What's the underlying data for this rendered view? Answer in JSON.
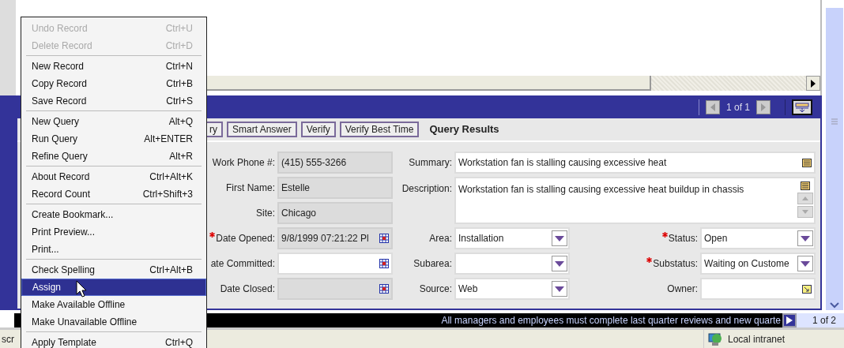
{
  "context_menu": {
    "groups": [
      [
        {
          "label": "Undo Record",
          "shortcut": "Ctrl+U",
          "disabled": true,
          "selected": false
        },
        {
          "label": "Delete Record",
          "shortcut": "Ctrl+D",
          "disabled": true,
          "selected": false
        }
      ],
      [
        {
          "label": "New Record",
          "shortcut": "Ctrl+N",
          "disabled": false,
          "selected": false
        },
        {
          "label": "Copy Record",
          "shortcut": "Ctrl+B",
          "disabled": false,
          "selected": false
        },
        {
          "label": "Save Record",
          "shortcut": "Ctrl+S",
          "disabled": false,
          "selected": false
        }
      ],
      [
        {
          "label": "New Query",
          "shortcut": "Alt+Q",
          "disabled": false,
          "selected": false
        },
        {
          "label": "Run Query",
          "shortcut": "Alt+ENTER",
          "disabled": false,
          "selected": false
        },
        {
          "label": "Refine Query",
          "shortcut": "Alt+R",
          "disabled": false,
          "selected": false
        }
      ],
      [
        {
          "label": "About Record",
          "shortcut": "Ctrl+Alt+K",
          "disabled": false,
          "selected": false
        },
        {
          "label": "Record Count",
          "shortcut": "Ctrl+Shift+3",
          "disabled": false,
          "selected": false
        }
      ],
      [
        {
          "label": "Create Bookmark...",
          "disabled": false,
          "selected": false
        },
        {
          "label": "Print Preview...",
          "disabled": false,
          "selected": false
        },
        {
          "label": "Print...",
          "disabled": false,
          "selected": false
        }
      ],
      [
        {
          "label": "Check Spelling",
          "shortcut": "Ctrl+Alt+B",
          "disabled": false,
          "selected": false
        },
        {
          "label": "Assign",
          "disabled": false,
          "selected": true
        },
        {
          "label": "Make Available Offline",
          "disabled": false,
          "selected": false
        },
        {
          "label": "Make Unavailable Offline",
          "disabled": false,
          "selected": false
        }
      ],
      [
        {
          "label": "Apply Template",
          "shortcut": "Ctrl+Q",
          "disabled": false,
          "selected": false
        }
      ]
    ]
  },
  "record_panel": {
    "pager": "1 of 1",
    "toolbar": {
      "buttons": [
        "ry",
        "Smart Answer",
        "Verify",
        "Verify Best Time"
      ],
      "title": "Query Results"
    },
    "left_fields": [
      {
        "label": "Work Phone #:",
        "value": "(415) 555-3266",
        "kind": "text",
        "readonly": true,
        "required": false
      },
      {
        "label": "First Name:",
        "value": "Estelle",
        "kind": "text",
        "readonly": true,
        "required": false
      },
      {
        "label": "Site:",
        "value": "Chicago",
        "kind": "text",
        "readonly": true,
        "required": false
      },
      {
        "label": "Date Opened:",
        "value": "9/8/1999 07:21:22 Pl",
        "kind": "date",
        "readonly": true,
        "required": true
      },
      {
        "label": "ate Committed:",
        "kind": "date",
        "readonly": false,
        "required": false
      },
      {
        "label": "Date Closed:",
        "kind": "date",
        "readonly": true,
        "required": false
      }
    ],
    "wide_fields": [
      {
        "label": "Summary:",
        "value": "Workstation fan is stalling causing excessive heat",
        "kind": "text"
      },
      {
        "label": "Description:",
        "value": "Workstation fan is stalling causing excessive heat buildup in chassis",
        "kind": "memo"
      }
    ],
    "middle_fields": [
      {
        "label": "Area:",
        "value": "Installation",
        "kind": "select",
        "required": false
      },
      {
        "label": "Subarea:",
        "kind": "select",
        "required": false
      },
      {
        "label": "Source:",
        "value": "Web",
        "kind": "select",
        "required": false
      }
    ],
    "right_fields": [
      {
        "label": "Status:",
        "value": "Open",
        "kind": "select",
        "required": true
      },
      {
        "label": "Substatus:",
        "value": "Waiting on Custome",
        "kind": "select",
        "required": true
      },
      {
        "label": "Owner:",
        "kind": "lookup",
        "required": false
      }
    ]
  },
  "ticker": {
    "text": "All managers and employees must complete last quarter reviews and new quarte",
    "pager": "1 of 2"
  },
  "status_bar": {
    "left_text": "scr",
    "zone": "Local intranet"
  }
}
